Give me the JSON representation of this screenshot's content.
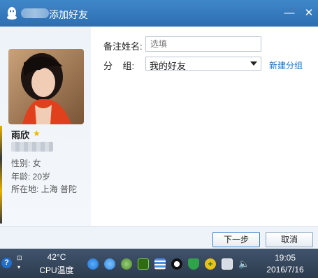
{
  "window": {
    "title": "添加好友",
    "minimize": "—",
    "close": "✕"
  },
  "profile": {
    "nickname": "雨欣",
    "gender": "性别: 女",
    "age": "年龄: 20岁",
    "location": "所在地: 上海 普陀"
  },
  "form": {
    "remark_label": "备注姓名:",
    "remark_placeholder": "选填",
    "group_label": "分    组:",
    "group_value": "我的好友",
    "new_group_link": "新建分组"
  },
  "footer": {
    "next_label": "下一步",
    "cancel_label": "取消"
  },
  "taskbar": {
    "temperature": "42°C",
    "cpu_label": "CPU温度",
    "time": "19:05",
    "date": "2016/7/16"
  },
  "icons": {
    "help": "help-icon",
    "tray": [
      "browser-icon",
      "browser2-icon",
      "user-icon",
      "nvidia-icon",
      "network-icon",
      "qq-icon",
      "shield-icon",
      "update-icon",
      "device-icon",
      "volume-icon"
    ]
  }
}
